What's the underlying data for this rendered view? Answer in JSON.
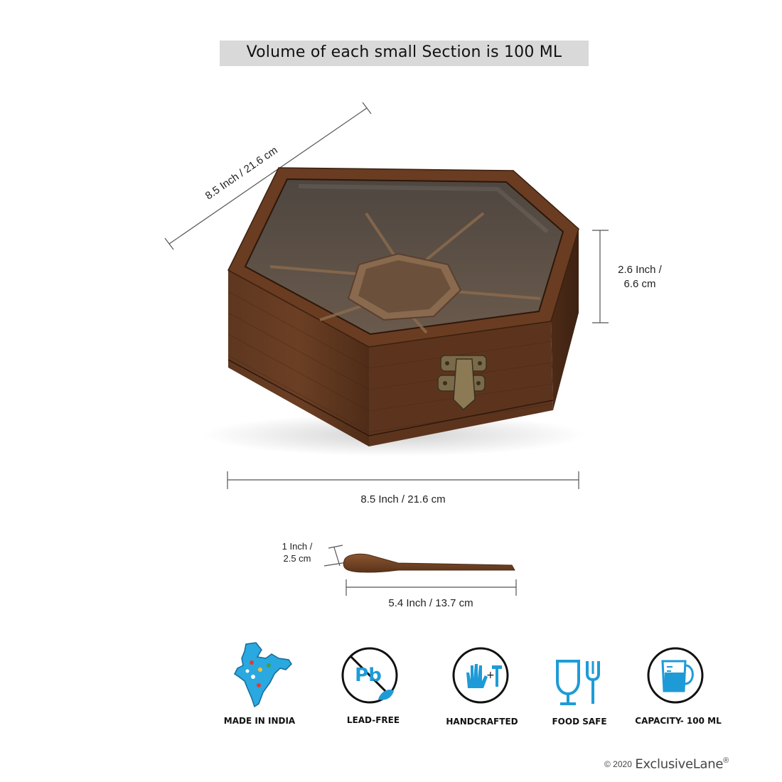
{
  "banner": {
    "text": "Volume of each small Section is 100 ML"
  },
  "dimensions": {
    "diagonal": "8.5 Inch / 21.6 cm",
    "height_line1": "2.6 Inch /",
    "height_line2": "6.6 cm",
    "width": "8.5 Inch / 21.6 cm",
    "spoon_width_line1": "1 Inch /",
    "spoon_width_line2": "2.5 cm",
    "spoon_length": "5.4 Inch / 13.7 cm"
  },
  "badges": [
    {
      "icon": "india-map-icon",
      "label": "MADE IN INDIA"
    },
    {
      "icon": "lead-free-icon",
      "label": "LEAD-FREE"
    },
    {
      "icon": "handcrafted-icon",
      "label": "HANDCRAFTED"
    },
    {
      "icon": "food-safe-icon",
      "label": "FOOD SAFE"
    },
    {
      "icon": "jug-icon",
      "label": "CAPACITY- 100 ML"
    }
  ],
  "footer": {
    "copyright": "© 2020",
    "brand": "ExclusiveLane",
    "registered": "®"
  },
  "colors": {
    "wood": "#5a321c",
    "icon_blue": "#1e9bd7",
    "banner_bg": "#d9d9d9"
  }
}
